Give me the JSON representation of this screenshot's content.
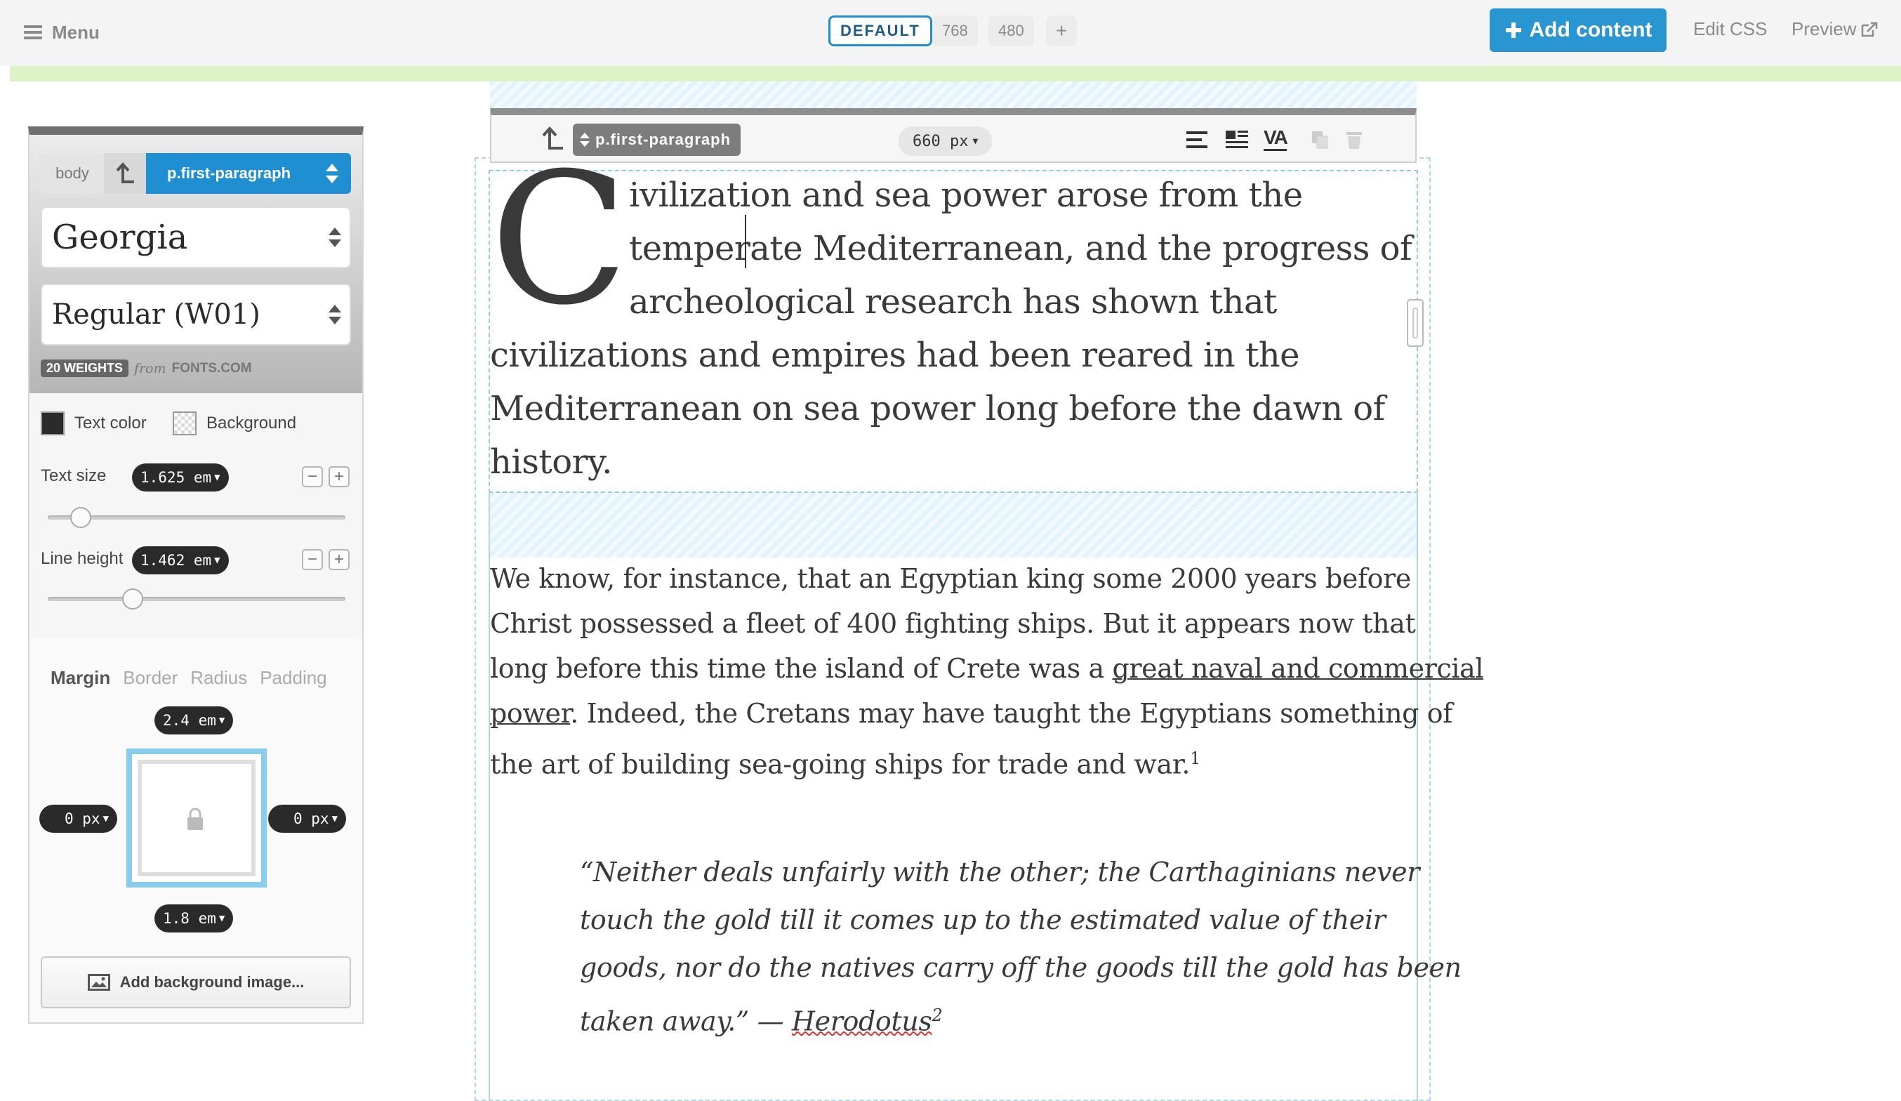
{
  "topbar": {
    "menu_label": "Menu",
    "breakpoints": [
      "DEFAULT",
      "768",
      "480",
      "+"
    ],
    "add_content_label": "Add content",
    "edit_css_label": "Edit CSS",
    "preview_label": "Preview"
  },
  "panel": {
    "breadcrumb_body": "body",
    "breadcrumb_selected": "p.first-paragraph",
    "font_family": "Georgia",
    "font_weight": "Regular (W01)",
    "weights_badge": "20 WEIGHTS",
    "weights_from": "from",
    "weights_source": "FONTS.COM",
    "text_color_label": "Text color",
    "background_label": "Background",
    "text_size_label": "Text size",
    "text_size_value": "1.625 em",
    "text_size_slider_fraction": 0.08,
    "line_height_label": "Line height",
    "line_height_value": "1.462 em",
    "line_height_slider_fraction": 0.27,
    "box_tabs": [
      "Margin",
      "Border",
      "Radius",
      "Padding"
    ],
    "active_tab": "Margin",
    "margin_top": "2.4 em",
    "margin_left": "0 px",
    "margin_right": "0 px",
    "margin_bottom": "1.8 em",
    "add_background_label": "Add background image..."
  },
  "toolbar": {
    "selector": "p.first-paragraph",
    "width_value": "660 px",
    "va_label": "VA"
  },
  "content": {
    "dropcap": "C",
    "first_paragraph_lines": [
      "ivilization and sea power arose from the",
      "temperate Mediterranean, and the progress of",
      "archeological research has shown that",
      "civilizations and empires had been reared in the",
      "Mediterranean on sea power long before the dawn of",
      "history."
    ],
    "p2_line1": "We know, for instance, that an Egyptian king some 2000 years before",
    "p2_line2": "Christ possessed a fleet of 400 fighting ships. But it appears now that",
    "p2_line3_a": "long before this time the island of Crete was a ",
    "p2_link_part1": "great naval and commercial",
    "p2_link_part2": "power",
    "p2_line4_b": ". Indeed, the Cretans may have taught the Egyptians something of",
    "p2_line5": "the art of building sea-going ships for trade and war.",
    "p2_footnote": "1",
    "quote_lines": [
      "“Neither deals unfairly with the other; the Carthaginians never",
      "touch the gold till it comes up to the estimated value of their",
      "goods, nor do the natives carry off the goods till the gold has been"
    ],
    "quote_last_a": "taken away.” — ",
    "quote_author": "Herodotus",
    "quote_footnote": "2"
  },
  "colors": {
    "accent": "#1f8fd1",
    "add_button": "#2996d2",
    "green_bar": "#dcf3c8",
    "text": "#3a3a3a"
  },
  "icons": [
    "hamburger-icon",
    "up-arrow-icon",
    "updown-icon",
    "align-left-icon",
    "align-justify-icon",
    "kerning-icon",
    "duplicate-icon",
    "trash-icon",
    "lock-icon",
    "image-icon",
    "external-link-icon",
    "plus-icon"
  ]
}
